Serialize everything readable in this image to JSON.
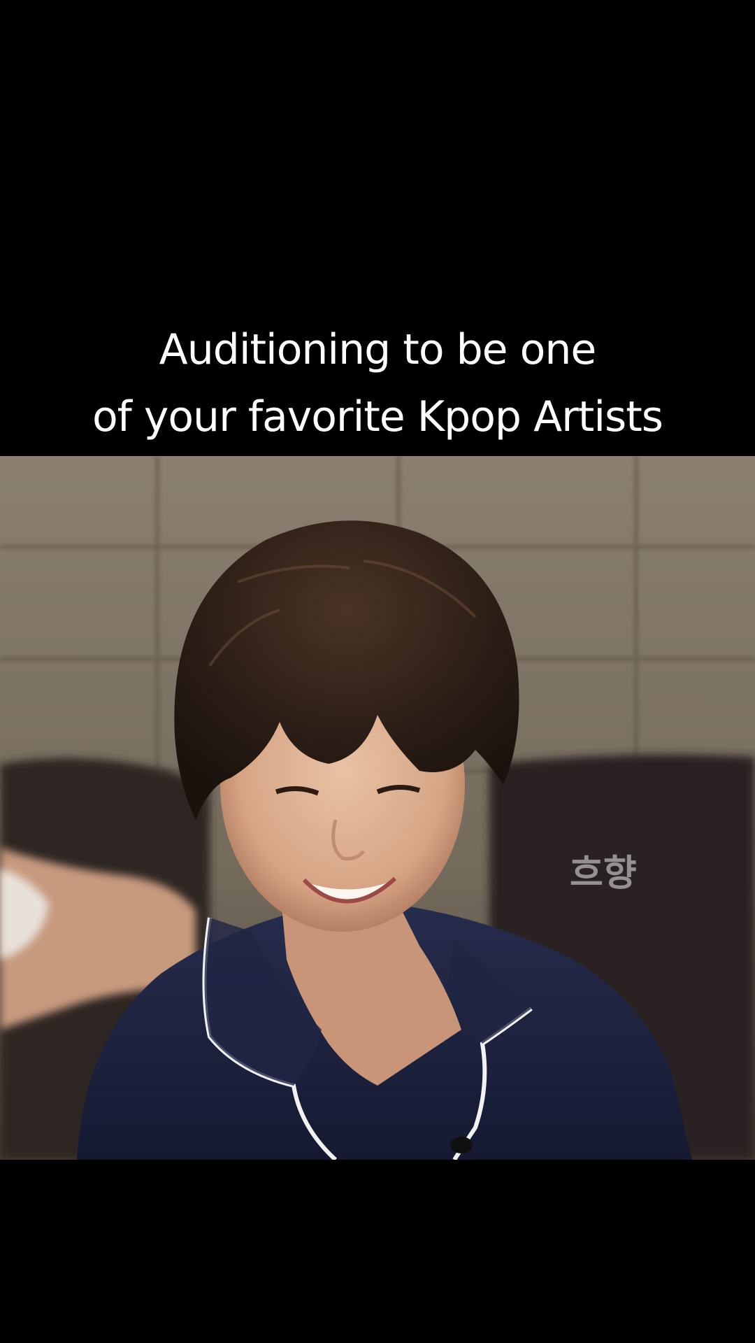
{
  "caption": {
    "line1": "Auditioning to be one",
    "line2": "of your favorite Kpop Artists"
  },
  "video": {
    "watermark": "흐향"
  },
  "colors": {
    "background": "#000000",
    "caption_text": "#ffffff",
    "pajama": "#1d2340",
    "pajama_trim": "#f2f2f2",
    "hair": "#2a1d16",
    "wall": "#7d7263"
  }
}
